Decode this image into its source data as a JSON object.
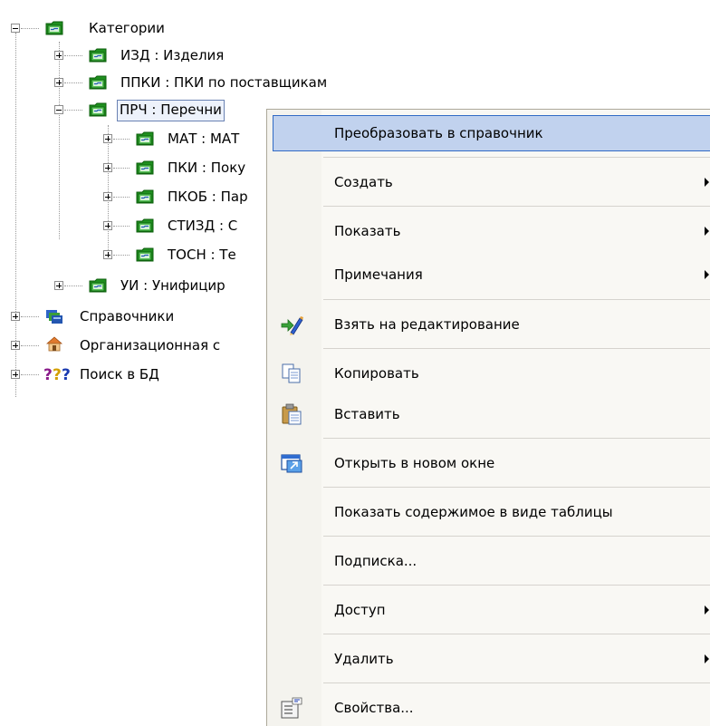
{
  "tree": {
    "root": "Категории",
    "children": [
      "ИЗД : Изделия",
      "ППКИ : ПКИ по поставщикам",
      "ПРЧ : Перечни",
      "МАТ : МАТ",
      "ПКИ : Поку",
      "ПКОБ : Пар",
      "СТИЗД : С",
      "ТОСН : Те",
      "УИ : Унифицир"
    ],
    "top_level": [
      "Справочники",
      "Организационная с",
      "Поиск в БД"
    ]
  },
  "menu": {
    "items": [
      {
        "label": "Преобразовать в справочник",
        "submenu": false,
        "icon": "",
        "highlighted": true
      },
      {
        "label": "Создать",
        "submenu": true,
        "icon": ""
      },
      {
        "label": "Показать",
        "submenu": true,
        "icon": ""
      },
      {
        "label": "Примечания",
        "submenu": true,
        "icon": ""
      },
      {
        "label": "Взять на  редактирование",
        "submenu": false,
        "icon": "edit-pencil-icon"
      },
      {
        "label": "Копировать",
        "submenu": false,
        "icon": "copy-icon"
      },
      {
        "label": "Вставить",
        "submenu": false,
        "icon": "paste-icon"
      },
      {
        "label": "Открыть в новом окне",
        "submenu": false,
        "icon": "new-window-icon"
      },
      {
        "label": "Показать содержимое в виде таблицы",
        "submenu": false,
        "icon": ""
      },
      {
        "label": "Подписка...",
        "submenu": false,
        "icon": ""
      },
      {
        "label": "Доступ",
        "submenu": true,
        "icon": ""
      },
      {
        "label": "Удалить",
        "submenu": true,
        "icon": ""
      },
      {
        "label": "Свойства...",
        "submenu": false,
        "icon": "properties-icon"
      }
    ]
  },
  "colors": {
    "folder_green": "#2e9e2e",
    "highlight_bg": "#c1d2ee",
    "highlight_border": "#316ac5",
    "menu_bg": "#f9f8f4"
  }
}
